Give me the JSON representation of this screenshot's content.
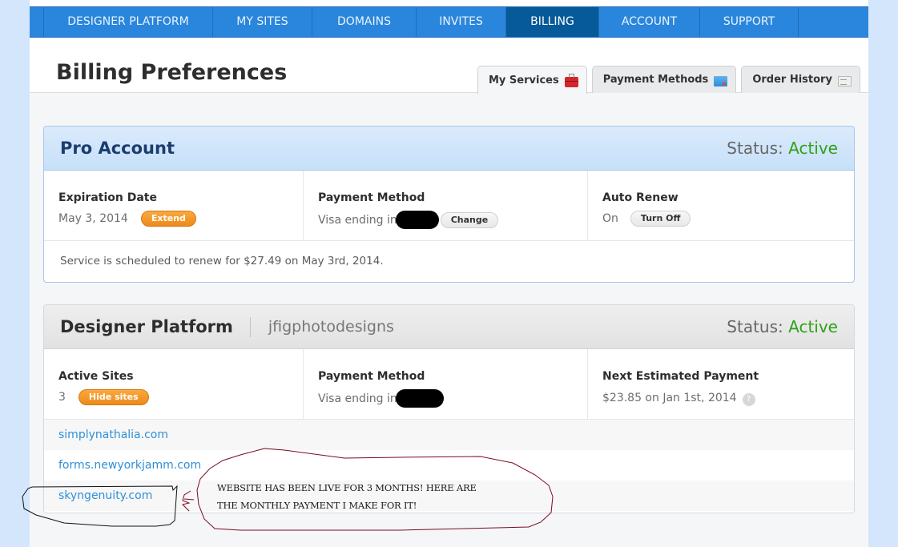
{
  "nav": {
    "items": [
      {
        "label": "DESIGNER PLATFORM",
        "active": false
      },
      {
        "label": "MY SITES",
        "active": false
      },
      {
        "label": "DOMAINS",
        "active": false
      },
      {
        "label": "INVITES",
        "active": false
      },
      {
        "label": "BILLING",
        "active": true
      },
      {
        "label": "ACCOUNT",
        "active": false
      },
      {
        "label": "SUPPORT",
        "active": false
      }
    ]
  },
  "page": {
    "title": "Billing Preferences"
  },
  "tabs": [
    {
      "label": "My Services",
      "icon": "toolbox-icon",
      "active": true
    },
    {
      "label": "Payment Methods",
      "icon": "credit-card-icon",
      "active": false
    },
    {
      "label": "Order History",
      "icon": "receipt-icon",
      "active": false
    }
  ],
  "pro_account": {
    "title": "Pro Account",
    "status_label": "Status:",
    "status_value": "Active",
    "expiration": {
      "label": "Expiration Date",
      "value": "May 3, 2014",
      "action": "Extend"
    },
    "payment": {
      "label": "Payment Method",
      "value": "Visa ending in",
      "action": "Change"
    },
    "auto_renew": {
      "label": "Auto Renew",
      "value": "On",
      "action": "Turn Off"
    },
    "note": "Service is scheduled to renew for $27.49 on May 3rd, 2014."
  },
  "designer_platform": {
    "title": "Designer Platform",
    "account_name": "jfigphotodesigns",
    "status_label": "Status:",
    "status_value": "Active",
    "active_sites": {
      "label": "Active Sites",
      "value": "3",
      "action": "Hide sites"
    },
    "payment": {
      "label": "Payment Method",
      "value": "Visa ending in"
    },
    "next_payment": {
      "label": "Next Estimated Payment",
      "value": "$23.85 on Jan 1st, 2014",
      "help": "?"
    },
    "sites": [
      "simplynathalia.com",
      "forms.newyorkjamm.com",
      "skyngenuity.com"
    ]
  },
  "annotation": {
    "line1": "WEBSITE HAS BEEN LIVE FOR 3 MONTHS! HERE ARE",
    "line2": "THE MONTHLY PAYMENT I MAKE FOR IT!"
  },
  "colors": {
    "nav_bg": "#2a86dc",
    "nav_active": "#075a99",
    "status_active": "#2ea01a",
    "pill_orange": "#f29520",
    "link": "#2f8fd6",
    "annotation_red": "#7a0a1e"
  }
}
